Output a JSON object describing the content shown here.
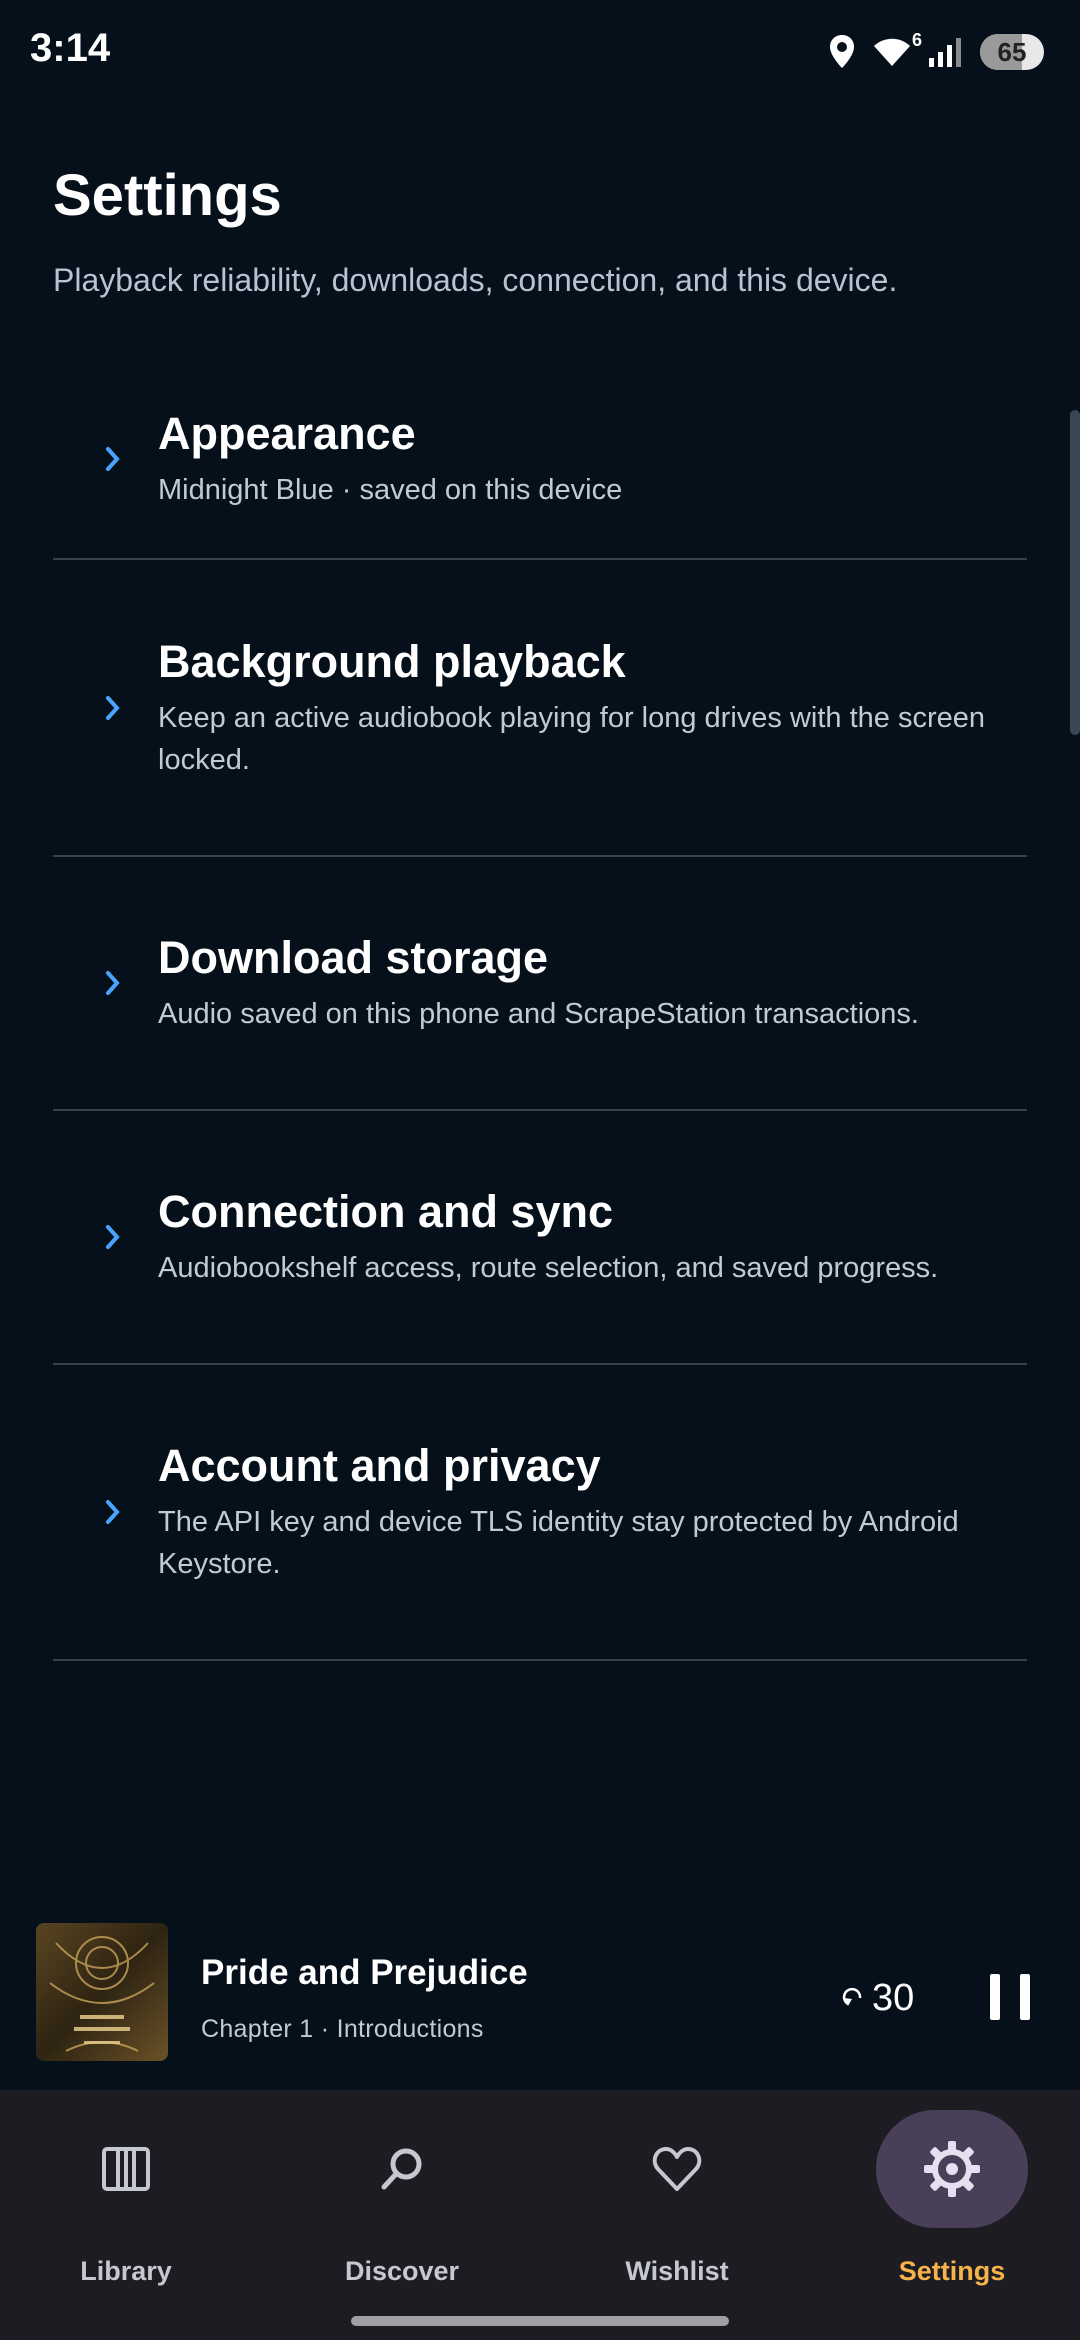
{
  "status_bar": {
    "time": "3:14",
    "wifi_badge": "6",
    "battery_level": "65",
    "battery_fraction": 0.65
  },
  "header": {
    "title": "Settings",
    "subtitle": "Playback reliability, downloads, connection, and this device."
  },
  "settings": {
    "items": [
      {
        "title": "Appearance",
        "subtitle": "Midnight Blue · saved on this device"
      },
      {
        "title": "Background playback",
        "subtitle": "Keep an active audiobook playing for long drives with the screen locked."
      },
      {
        "title": "Download storage",
        "subtitle": "Audio saved on this phone and ScrapeStation transactions."
      },
      {
        "title": "Connection and sync",
        "subtitle": "Audiobookshelf access, route selection, and saved progress."
      },
      {
        "title": "Account and privacy",
        "subtitle": "The API key and device TLS identity stay protected by Android Keystore."
      }
    ]
  },
  "now_playing": {
    "title": "Pride and Prejudice",
    "subtitle": "Chapter 1 · Introductions",
    "rewind_seconds": "30",
    "cover_icon": "book-cover-icon"
  },
  "nav": {
    "items": [
      {
        "label": "Library",
        "icon": "library-icon",
        "active": false
      },
      {
        "label": "Discover",
        "icon": "search-icon",
        "active": false
      },
      {
        "label": "Wishlist",
        "icon": "heart-icon",
        "active": false
      },
      {
        "label": "Settings",
        "icon": "gear-icon",
        "active": true
      }
    ]
  },
  "colors": {
    "background": "#06101a",
    "accent_chevron": "#4aa3ff",
    "active_nav_label": "#f6b34a",
    "active_nav_pill": "#4a3f59",
    "nav_bar": "#1d1c22"
  }
}
